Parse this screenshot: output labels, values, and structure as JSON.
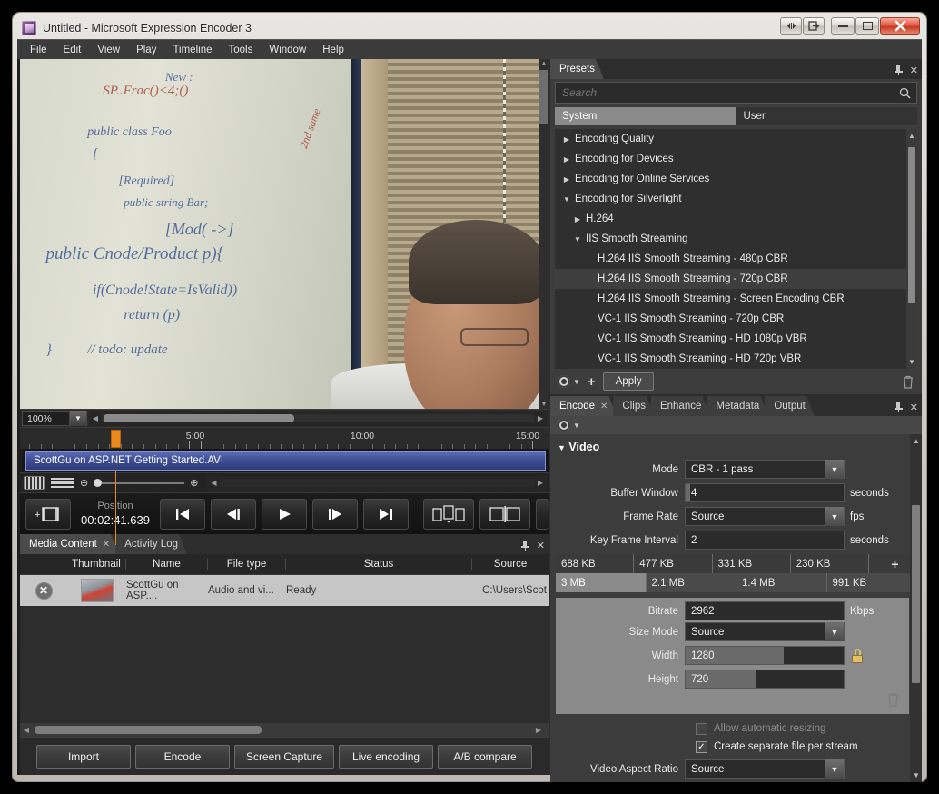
{
  "window": {
    "title": "Untitled - Microsoft Expression Encoder 3",
    "icon": "expression-encoder-icon",
    "buttons": {
      "expand": "◂▸",
      "restore_down": "➡",
      "minimize": "–",
      "maximize": "▭",
      "close": "✕"
    }
  },
  "menubar": {
    "items": [
      "File",
      "Edit",
      "View",
      "Play",
      "Timeline",
      "Tools",
      "Window",
      "Help"
    ]
  },
  "preview": {
    "zoom": "100%",
    "ink_lines": [
      "public class Foo",
      "{",
      "[Required]",
      "public string Bar;",
      "public Cnode/Product p){",
      "if(Cnode!State=IsValid))",
      "return (p)",
      "// todo: update"
    ]
  },
  "timeline": {
    "ticks": [
      "5:00",
      "10:00",
      "15:00"
    ],
    "clip_name": "ScottGu on ASP.NET Getting Started.AVI",
    "playhead_position": "00:02:41.639"
  },
  "transport": {
    "add_marker": "add-marker-icon",
    "position_label": "Position",
    "position_value": "00:02:41.639",
    "buttons": [
      {
        "name": "skip-to-start-button",
        "glyph": "prev-start"
      },
      {
        "name": "step-back-button",
        "glyph": "step-back"
      },
      {
        "name": "play-button",
        "glyph": "play"
      },
      {
        "name": "step-forward-button",
        "glyph": "step-forward"
      },
      {
        "name": "skip-to-end-button",
        "glyph": "next-end"
      },
      {
        "name": "split-clip-button",
        "glyph": "split"
      },
      {
        "name": "trim-clip-button",
        "glyph": "trim"
      }
    ]
  },
  "media_panel": {
    "tabs": [
      {
        "label": "Media Content",
        "active": true,
        "closable": true
      },
      {
        "label": "Activity Log",
        "active": false,
        "closable": false
      }
    ],
    "columns": [
      "Thumbnail",
      "Name",
      "File type",
      "Status",
      "Source"
    ],
    "rows": [
      {
        "remove": "✕",
        "thumbnail": "video-thumbnail",
        "name": "ScottGu on ASP....",
        "file_type": "Audio and vi...",
        "status": "Ready",
        "source": "C:\\Users\\Scot"
      }
    ]
  },
  "bottom_buttons": [
    "Import",
    "Encode",
    "Screen Capture",
    "Live encoding",
    "A/B compare"
  ],
  "presets": {
    "title": "Presets",
    "search_placeholder": "Search",
    "search_value": "",
    "tabs": [
      {
        "label": "System",
        "active": true
      },
      {
        "label": "User",
        "active": false
      }
    ],
    "tree": [
      {
        "label": "Encoding Quality",
        "indent": 0,
        "state": "collapsed",
        "selected": false
      },
      {
        "label": "Encoding for Devices",
        "indent": 0,
        "state": "collapsed",
        "selected": false
      },
      {
        "label": "Encoding for Online Services",
        "indent": 0,
        "state": "collapsed",
        "selected": false
      },
      {
        "label": "Encoding for Silverlight",
        "indent": 0,
        "state": "expanded",
        "selected": false
      },
      {
        "label": "H.264",
        "indent": 1,
        "state": "collapsed",
        "selected": false
      },
      {
        "label": "IIS Smooth Streaming",
        "indent": 1,
        "state": "expanded",
        "selected": false
      },
      {
        "label": "H.264 IIS Smooth Streaming - 480p CBR",
        "indent": 2,
        "state": "leaf",
        "selected": false
      },
      {
        "label": "H.264 IIS Smooth Streaming - 720p CBR",
        "indent": 2,
        "state": "leaf",
        "selected": true
      },
      {
        "label": "H.264 IIS Smooth Streaming - Screen Encoding CBR",
        "indent": 2,
        "state": "leaf",
        "selected": false
      },
      {
        "label": "VC-1 IIS Smooth Streaming - 720p CBR",
        "indent": 2,
        "state": "leaf",
        "selected": false
      },
      {
        "label": "VC-1 IIS Smooth Streaming - HD 1080p VBR",
        "indent": 2,
        "state": "leaf",
        "selected": false
      },
      {
        "label": "VC-1 IIS Smooth Streaming - HD 720p VBR",
        "indent": 2,
        "state": "leaf",
        "selected": false
      }
    ],
    "toolbar": {
      "settings": "gear-icon",
      "add": "+",
      "apply_label": "Apply",
      "delete": "trash-icon"
    }
  },
  "encode": {
    "tabs": [
      {
        "label": "Encode",
        "active": true,
        "closable": true
      },
      {
        "label": "Clips",
        "active": false,
        "closable": false
      },
      {
        "label": "Enhance",
        "active": false,
        "closable": false
      },
      {
        "label": "Metadata",
        "active": false,
        "closable": false
      },
      {
        "label": "Output",
        "active": false,
        "closable": false
      }
    ],
    "video_section_title": "Video",
    "fields": {
      "mode_label": "Mode",
      "mode_value": "CBR - 1 pass",
      "buffer_label": "Buffer Window",
      "buffer_value": "4",
      "buffer_unit": "seconds",
      "framerate_label": "Frame Rate",
      "framerate_value": "Source",
      "framerate_unit": "fps",
      "keyframe_label": "Key Frame Interval",
      "keyframe_value": "2",
      "keyframe_unit": "seconds",
      "bitrate_label": "Bitrate",
      "bitrate_value": "2962",
      "bitrate_unit": "Kbps",
      "sizemode_label": "Size Mode",
      "sizemode_value": "Source",
      "width_label": "Width",
      "width_value": "1280",
      "height_label": "Height",
      "height_value": "720",
      "aspect_label": "Video Aspect Ratio",
      "aspect_value": "Source"
    },
    "streams_row1": [
      "688 KB",
      "477 KB",
      "331 KB",
      "230 KB"
    ],
    "streams_add": "+",
    "streams_row2": [
      "3 MB",
      "2.1 MB",
      "1.4 MB",
      "991 KB"
    ],
    "checkboxes": [
      {
        "label": "Allow automatic resizing",
        "checked": false,
        "enabled": false
      },
      {
        "label": "Create separate file per stream",
        "checked": true,
        "enabled": true
      }
    ]
  }
}
